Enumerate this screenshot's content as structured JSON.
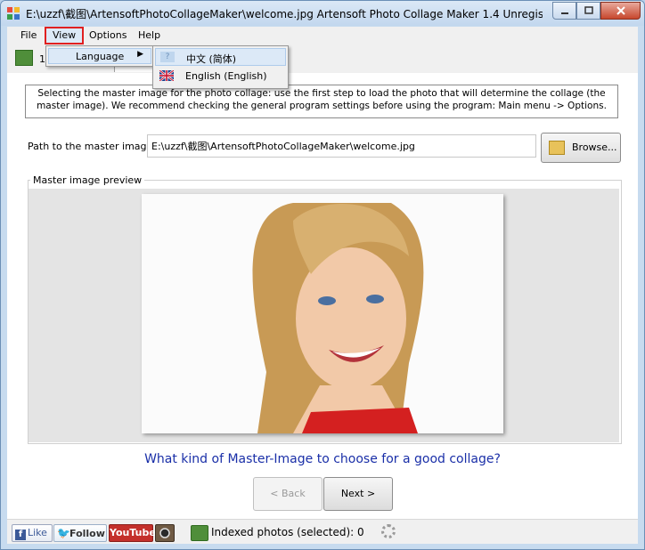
{
  "window": {
    "title": "E:\\uzzf\\截图\\ArtensoftPhotoCollageMaker\\welcome.jpg Artensoft Photo Collage Maker 1.4  Unregis...",
    "min_icon": "minimize-icon",
    "max_icon": "maximize-icon",
    "close_icon": "close-icon"
  },
  "menubar": {
    "file": "File",
    "view": "View",
    "options": "Options",
    "help": "Help"
  },
  "view_menu": {
    "language": "Language",
    "language_arrow": "▶"
  },
  "language_submenu": {
    "items": [
      {
        "label": "中文 (简体)",
        "icon_char": "?"
      },
      {
        "label": "English (English)"
      }
    ]
  },
  "tabs": {
    "step1_label": "1."
  },
  "instructions": {
    "text": "Selecting the master image for the photo collage: use the first step to load the photo that will determine the collage (the master image). We recommend checking the general program settings before using the program: Main menu -> Options."
  },
  "master": {
    "path_label": "Path to the master image:",
    "path_value": "E:\\uzzf\\截图\\ArtensoftPhotoCollageMaker\\welcome.jpg",
    "browse_label": "Browse...",
    "preview_legend": "Master image preview"
  },
  "question": "What kind of Master-Image to choose for a good collage?",
  "nav": {
    "back": "< Back",
    "next": "Next >"
  },
  "statusbar": {
    "like": "Like",
    "like_glyph": "f",
    "follow": "Follow",
    "follow_glyph": "🐦",
    "youtube": "YouTube",
    "indexed": "Indexed photos (selected): 0"
  },
  "colors": {
    "accent_highlight": "#dce9f7",
    "question_text": "#1a2fa8",
    "menu_outline": "#e02020"
  }
}
